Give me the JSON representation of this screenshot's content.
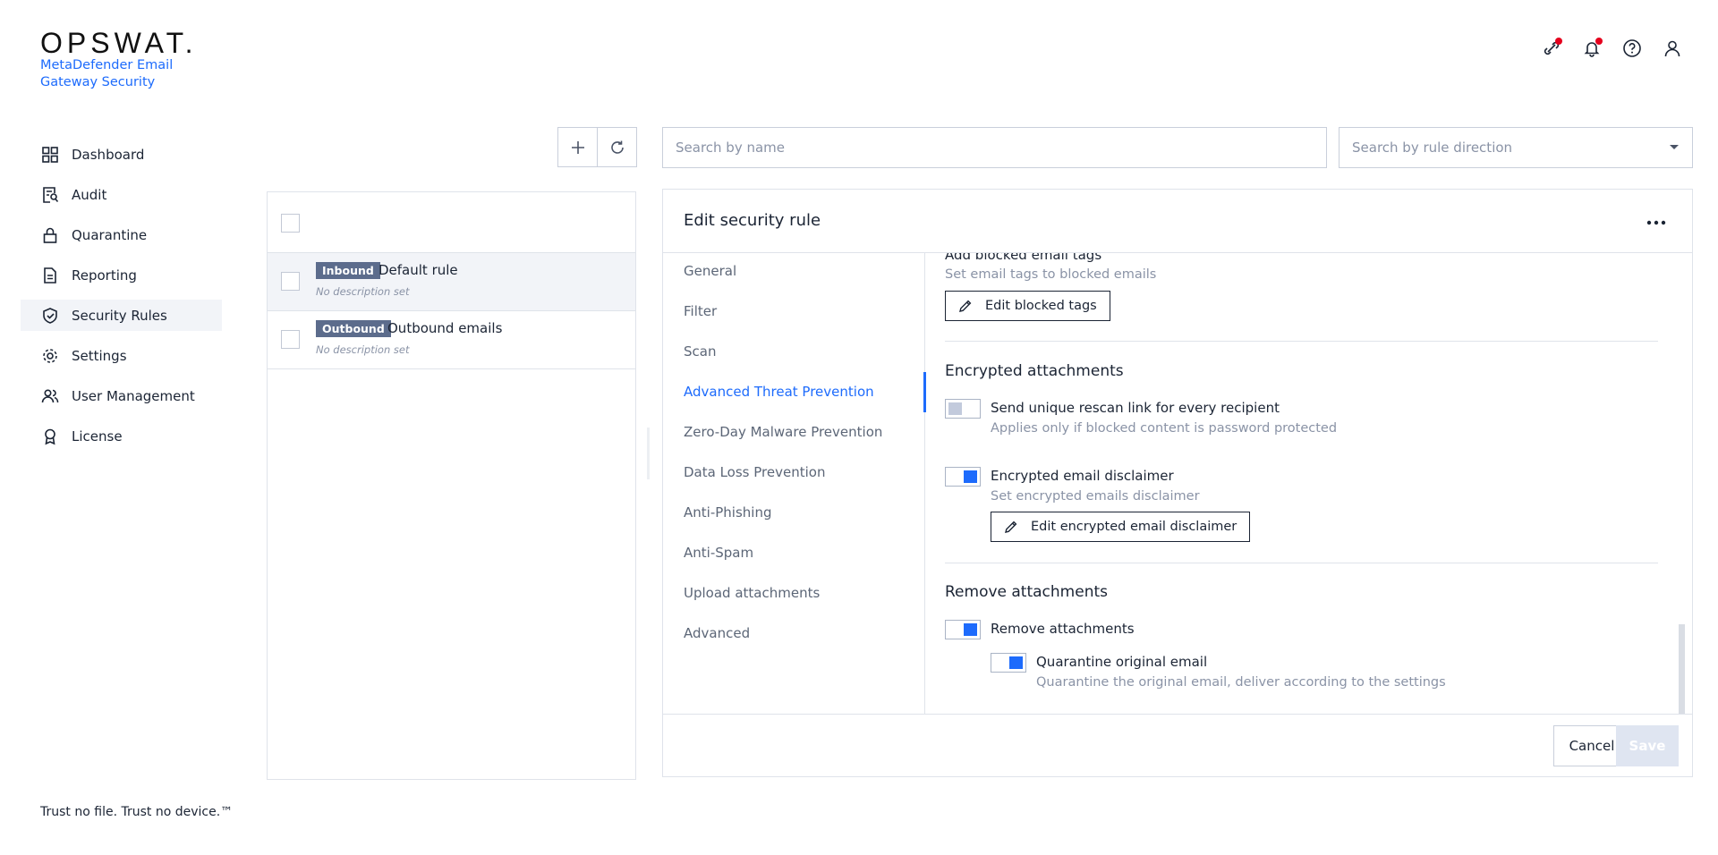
{
  "brand": {
    "logo_text": "OPSWAT.",
    "product_name": "MetaDefender Email Gateway Security",
    "tagline": "Trust no file. Trust no device.™"
  },
  "header_icons": [
    "integration-icon",
    "bell-icon",
    "help-icon",
    "user-icon"
  ],
  "sidebar": {
    "items": [
      {
        "label": "Dashboard",
        "icon": "dashboard-icon",
        "active": false
      },
      {
        "label": "Audit",
        "icon": "audit-icon",
        "active": false
      },
      {
        "label": "Quarantine",
        "icon": "lock-icon",
        "active": false
      },
      {
        "label": "Reporting",
        "icon": "document-icon",
        "active": false
      },
      {
        "label": "Security Rules",
        "icon": "shield-check-icon",
        "active": true
      },
      {
        "label": "Settings",
        "icon": "gear-icon",
        "active": false
      },
      {
        "label": "User Management",
        "icon": "users-icon",
        "active": false
      },
      {
        "label": "License",
        "icon": "award-icon",
        "active": false
      }
    ]
  },
  "search": {
    "name_placeholder": "Search by name",
    "direction_placeholder": "Search by rule direction"
  },
  "rules": [
    {
      "badge": "Inbound",
      "name": "Default rule",
      "description": "No description set",
      "selected": true
    },
    {
      "badge": "Outbound",
      "name": "Outbound emails",
      "description": "No description set",
      "selected": false
    }
  ],
  "edit": {
    "title": "Edit security rule",
    "tabs": [
      {
        "label": "General",
        "active": false
      },
      {
        "label": "Filter",
        "active": false
      },
      {
        "label": "Scan",
        "active": false
      },
      {
        "label": "Advanced Threat Prevention",
        "active": true
      },
      {
        "label": "Zero-Day Malware Prevention",
        "active": false
      },
      {
        "label": "Data Loss Prevention",
        "active": false
      },
      {
        "label": "Anti-Phishing",
        "active": false
      },
      {
        "label": "Anti-Spam",
        "active": false
      },
      {
        "label": "Upload attachments",
        "active": false
      },
      {
        "label": "Advanced",
        "active": false
      }
    ],
    "content": {
      "blocked_tags_title": "Add blocked email tags",
      "blocked_tags_desc": "Set email tags to blocked emails",
      "edit_blocked_tags_label": "Edit blocked tags",
      "encrypted_section_title": "Encrypted attachments",
      "rescan_link_label": "Send unique rescan link for every recipient",
      "rescan_link_desc": "Applies only if blocked content is password protected",
      "rescan_link_enabled": false,
      "disclaimer_label": "Encrypted email disclaimer",
      "disclaimer_desc": "Set encrypted emails disclaimer",
      "disclaimer_enabled": true,
      "edit_disclaimer_label": "Edit encrypted email disclaimer",
      "remove_section_title": "Remove attachments",
      "remove_label": "Remove attachments",
      "remove_enabled": true,
      "quarantine_label": "Quarantine original email",
      "quarantine_desc": "Quarantine the original email, deliver according to the settings",
      "quarantine_enabled": true
    },
    "cancel_label": "Cancel",
    "save_label": "Save"
  }
}
